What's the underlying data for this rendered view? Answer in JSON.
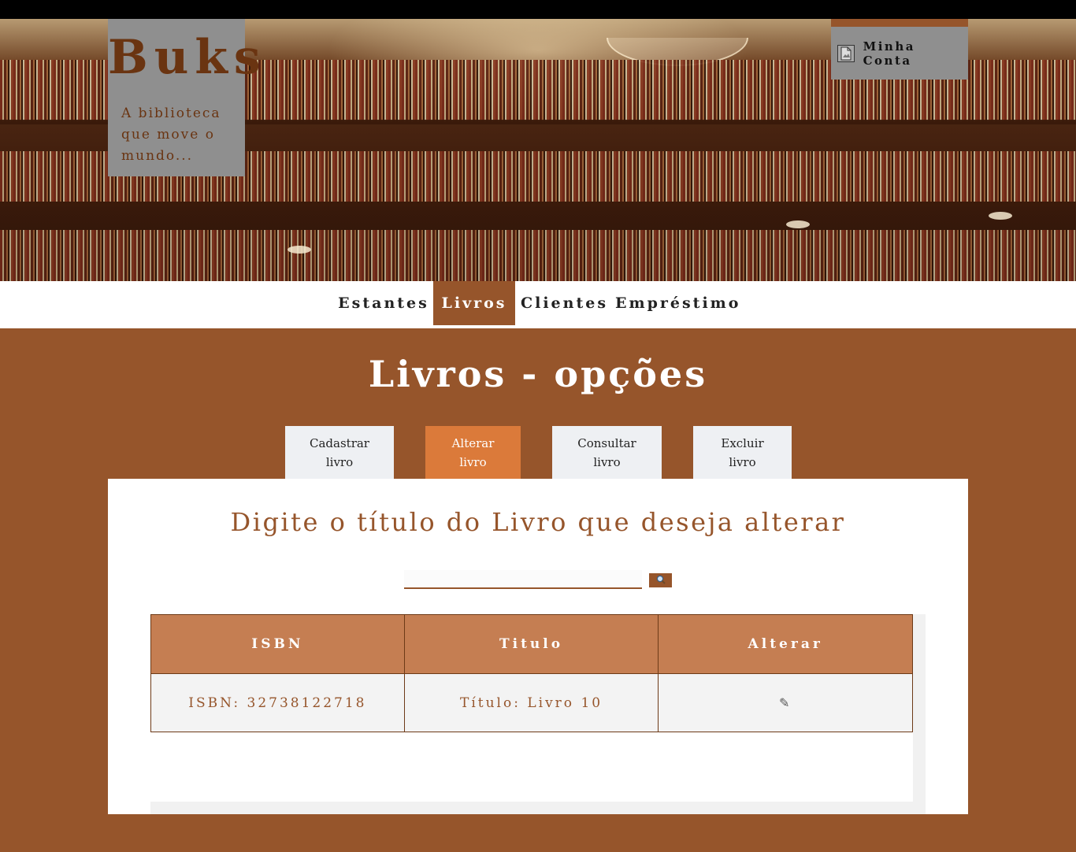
{
  "header": {
    "brand": "Buks",
    "tagline": "A biblioteca que move o mundo...",
    "account_label": "Minha Conta",
    "account_icon": "document-image-icon"
  },
  "nav": {
    "items": [
      {
        "label": "Estantes",
        "active": false
      },
      {
        "label": "Livros",
        "active": true
      },
      {
        "label": "Clientes",
        "active": false
      },
      {
        "label": "Empréstimo",
        "active": false
      }
    ]
  },
  "page": {
    "title": "Livros - opções"
  },
  "subtabs": [
    {
      "line1": "Cadastrar",
      "line2": "livro",
      "active": false
    },
    {
      "line1": "Alterar",
      "line2": "livro",
      "active": true
    },
    {
      "line1": "Consultar",
      "line2": "livro",
      "active": false
    },
    {
      "line1": "Excluir",
      "line2": "livro",
      "active": false
    }
  ],
  "search": {
    "heading": "Digite o título do Livro que deseja alterar",
    "value": "",
    "button_icon": "magnifier-icon"
  },
  "table": {
    "headers": [
      "ISBN",
      "Titulo",
      "Alterar"
    ],
    "rows": [
      {
        "isbn": "ISBN: 32738122718",
        "titulo": "Título: Livro 10",
        "action_icon": "pencil-icon",
        "action_glyph": "✎"
      }
    ]
  },
  "colors": {
    "brand_brown": "#96552b",
    "active_orange": "#db7a3a",
    "table_header": "#c57e52",
    "brand_box_gray": "#8f8f8f"
  }
}
